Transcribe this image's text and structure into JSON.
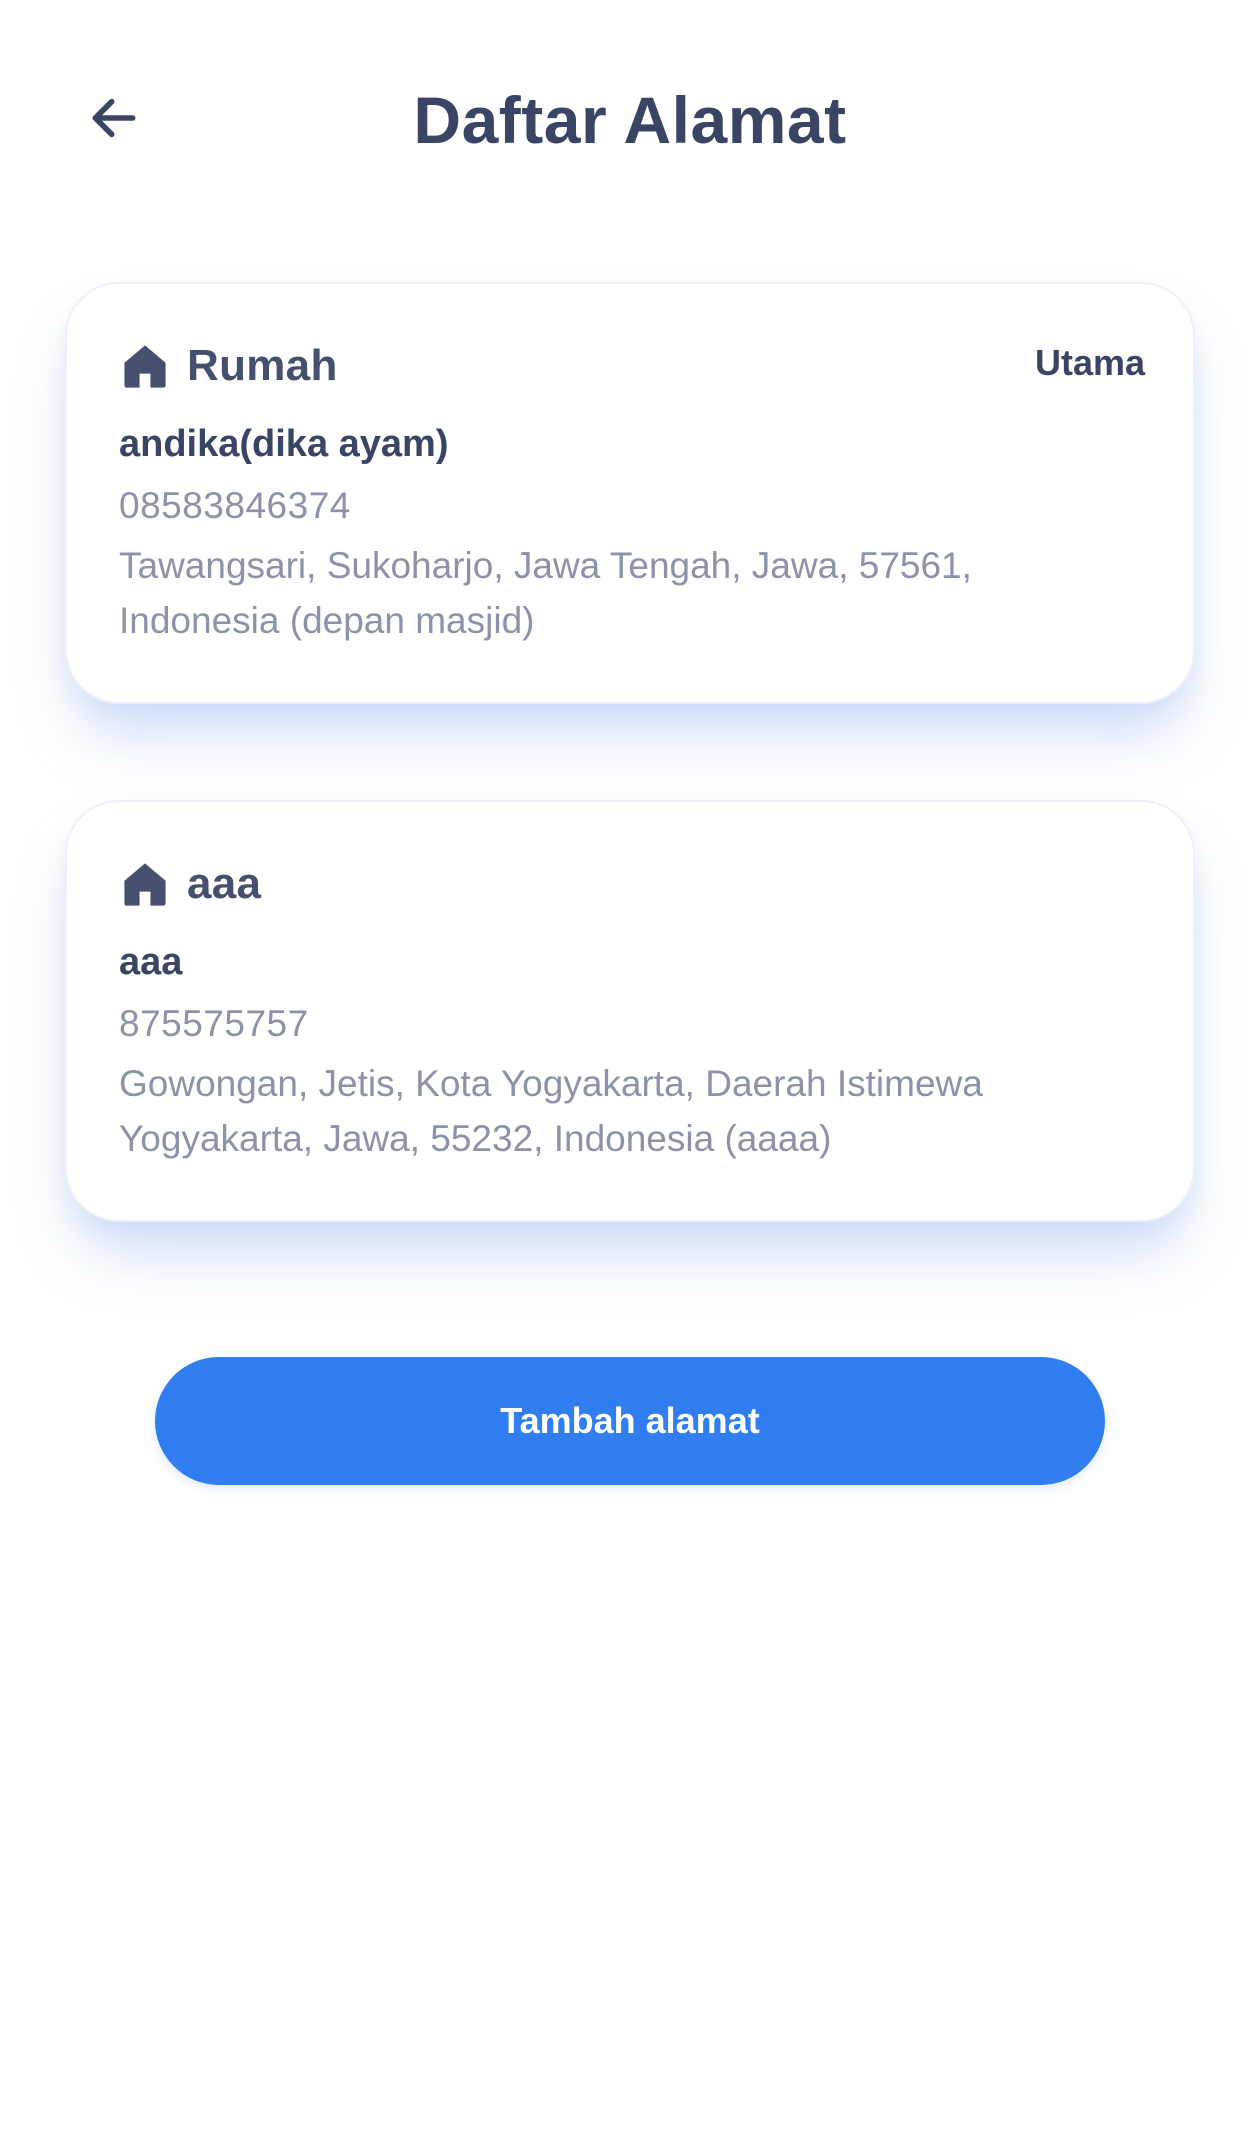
{
  "header": {
    "title": "Daftar Alamat",
    "back_icon": "arrow-left-icon"
  },
  "addresses": [
    {
      "label": "Rumah",
      "icon": "home-icon",
      "badge": "Utama",
      "recipient": "andika(dika ayam)",
      "phone": "08583846374",
      "address": "Tawangsari, Sukoharjo, Jawa Tengah, Jawa, 57561, Indonesia (depan masjid)"
    },
    {
      "label": "aaa",
      "icon": "home-icon",
      "recipient": "aaa",
      "phone": "875575757",
      "address": "Gowongan, Jetis, Kota Yogyakarta, Daerah Istimewa Yogyakarta, Jawa, 55232, Indonesia (aaaa)"
    }
  ],
  "actions": {
    "add_address_label": "Tambah alamat"
  },
  "colors": {
    "primary": "#307ef0",
    "title_text": "#3a4566",
    "muted_text": "#8c93a8",
    "icon": "#47506e"
  }
}
